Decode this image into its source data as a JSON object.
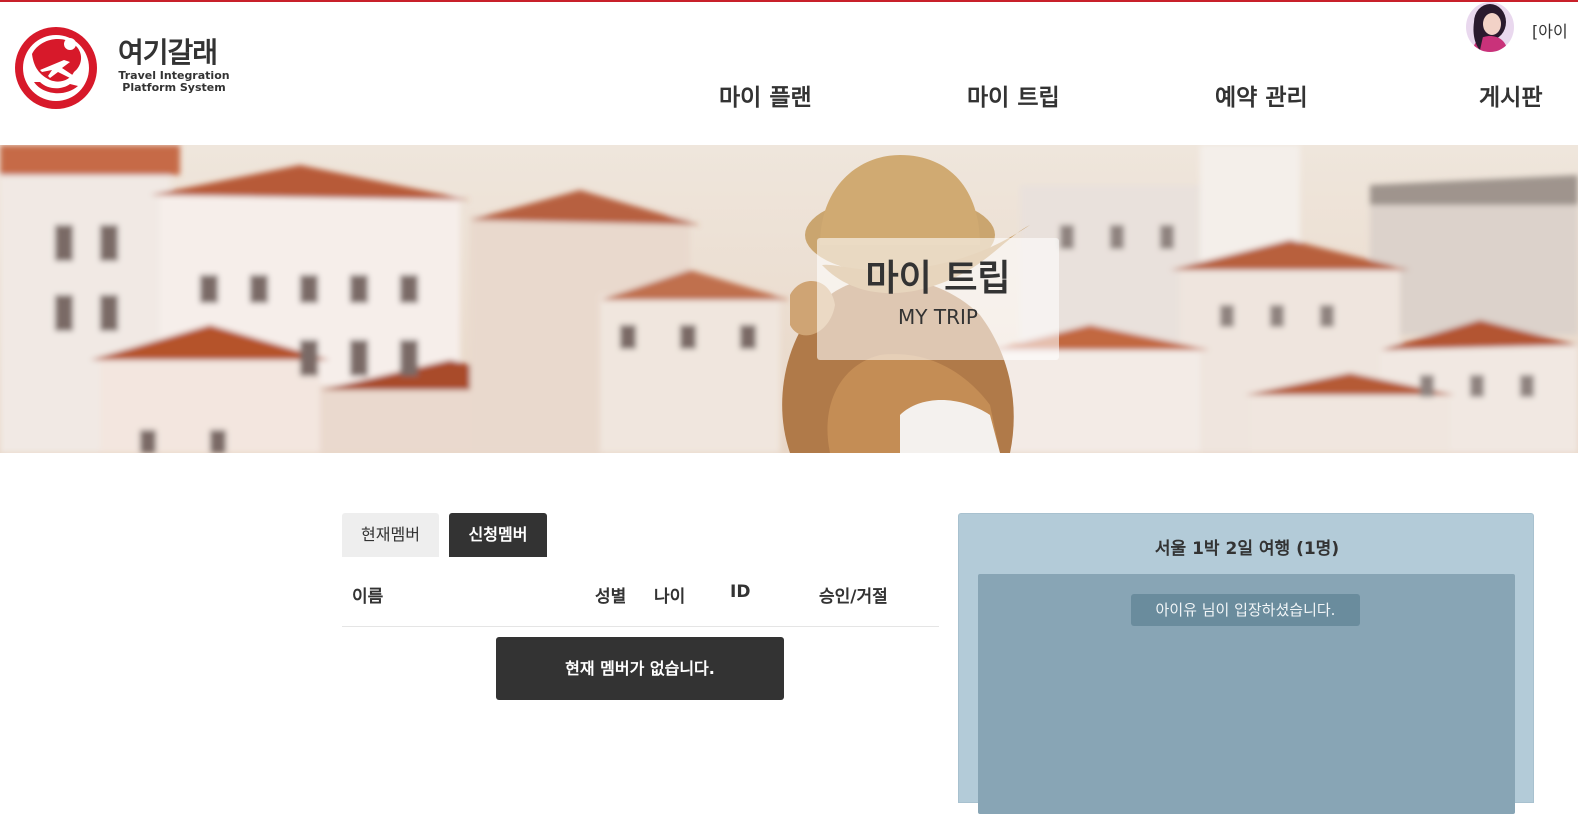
{
  "header": {
    "brand_name": "여기갈래",
    "brand_sub_line1": "Travel Integration",
    "brand_sub_line2": "Platform System",
    "nav": [
      "마이 플랜",
      "마이 트립",
      "예약 관리",
      "게시판"
    ],
    "user_label": "[아이"
  },
  "hero": {
    "title": "마이 트립",
    "subtitle": "MY TRIP"
  },
  "tabs": [
    {
      "label": "현재멤버",
      "active": false
    },
    {
      "label": "신청멤버",
      "active": true
    }
  ],
  "table": {
    "columns": [
      "이름",
      "성별",
      "나이",
      "ID",
      "승인/거절"
    ],
    "empty_message": "현재 멤버가 없습니다."
  },
  "chat": {
    "title": "서울 1박 2일 여행 (1명)",
    "notice": "아이유 님이 입장하셨습니다."
  },
  "colors": {
    "brand_red": "#d7192a",
    "dark_button": "#333333",
    "chat_outer": "#b3cbd8",
    "chat_inner": "#88a5b5",
    "chat_notice": "#6a8c9d"
  },
  "icons": {
    "logo": "plane-globe-logo",
    "avatar": "user-avatar"
  }
}
